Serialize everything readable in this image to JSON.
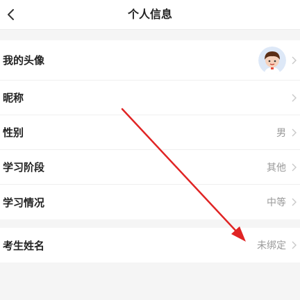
{
  "header": {
    "title": "个人信息"
  },
  "profile_rows": [
    {
      "label": "我的头像",
      "value": ""
    },
    {
      "label": "昵称",
      "value": ""
    },
    {
      "label": "性别",
      "value": "男"
    },
    {
      "label": "学习阶段",
      "value": "其他"
    },
    {
      "label": "学习情况",
      "value": "中等"
    }
  ],
  "exam_rows": [
    {
      "label": "考生姓名",
      "value": "未绑定"
    }
  ],
  "colors": {
    "annotation_arrow": "#e02424",
    "secondary_text": "#999999",
    "avatar_bg": "#dde8f7"
  }
}
